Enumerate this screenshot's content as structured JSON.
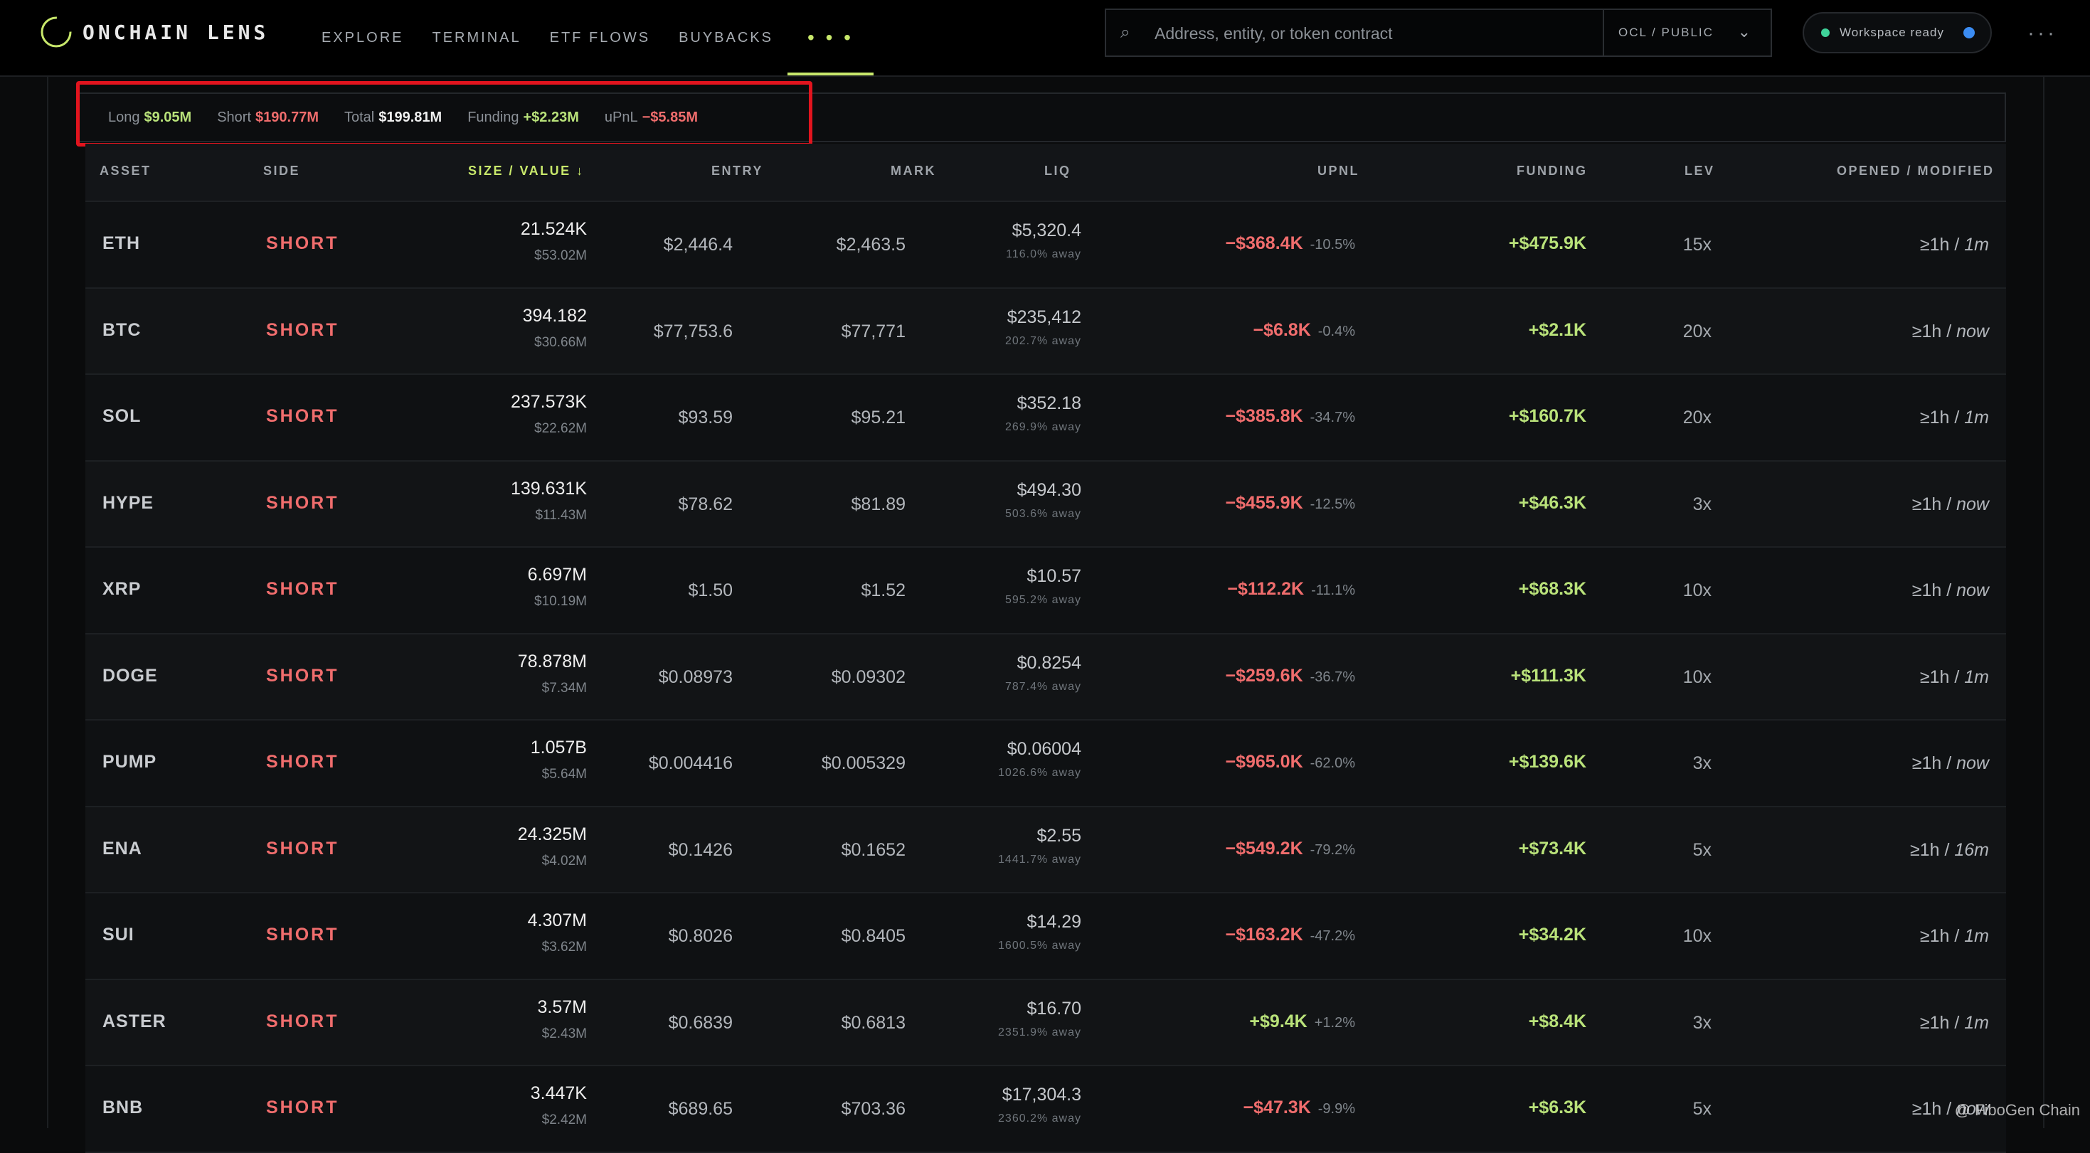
{
  "app": {
    "logo_text": "ONCHAIN LENS"
  },
  "nav": {
    "items": [
      "EXPLORE",
      "TERMINAL",
      "ETF FLOWS",
      "BUYBACKS"
    ],
    "more": "• • •"
  },
  "search": {
    "placeholder": "Address, entity, or token contract",
    "scope": "OCL / PUBLIC"
  },
  "workspace": {
    "status": "Workspace ready"
  },
  "summary": {
    "long_label": "Long",
    "long_value": "$9.05M",
    "short_label": "Short",
    "short_value": "$190.77M",
    "total_label": "Total",
    "total_value": "$199.81M",
    "funding_label": "Funding",
    "funding_value": "+$2.23M",
    "upnl_label": "uPnL",
    "upnl_value": "−$5.85M"
  },
  "table": {
    "headers": {
      "asset": "ASSET",
      "side": "SIDE",
      "size": "SIZE / VALUE ↓",
      "entry": "ENTRY",
      "mark": "MARK",
      "liq": "LIQ",
      "upnl": "UPNL",
      "funding": "FUNDING",
      "lev": "LEV",
      "opened": "OPENED / MODIFIED"
    },
    "rows": [
      {
        "asset": "ETH",
        "side": "SHORT",
        "size": "21.524K",
        "value": "$53.02M",
        "entry": "$2,446.4",
        "mark": "$2,463.5",
        "liq": "$5,320.4",
        "liq_away": "116.0% away",
        "upnl": "−$368.4K",
        "upnl_pct": "-10.5%",
        "upnl_positive": false,
        "funding": "+$475.9K",
        "lev": "15x",
        "opened": "≥1h / ",
        "modified": "1m"
      },
      {
        "asset": "BTC",
        "side": "SHORT",
        "size": "394.182",
        "value": "$30.66M",
        "entry": "$77,753.6",
        "mark": "$77,771",
        "liq": "$235,412",
        "liq_away": "202.7% away",
        "upnl": "−$6.8K",
        "upnl_pct": "-0.4%",
        "upnl_positive": false,
        "funding": "+$2.1K",
        "lev": "20x",
        "opened": "≥1h / ",
        "modified": "now"
      },
      {
        "asset": "SOL",
        "side": "SHORT",
        "size": "237.573K",
        "value": "$22.62M",
        "entry": "$93.59",
        "mark": "$95.21",
        "liq": "$352.18",
        "liq_away": "269.9% away",
        "upnl": "−$385.8K",
        "upnl_pct": "-34.7%",
        "upnl_positive": false,
        "funding": "+$160.7K",
        "lev": "20x",
        "opened": "≥1h / ",
        "modified": "1m"
      },
      {
        "asset": "HYPE",
        "side": "SHORT",
        "size": "139.631K",
        "value": "$11.43M",
        "entry": "$78.62",
        "mark": "$81.89",
        "liq": "$494.30",
        "liq_away": "503.6% away",
        "upnl": "−$455.9K",
        "upnl_pct": "-12.5%",
        "upnl_positive": false,
        "funding": "+$46.3K",
        "lev": "3x",
        "opened": "≥1h / ",
        "modified": "now"
      },
      {
        "asset": "XRP",
        "side": "SHORT",
        "size": "6.697M",
        "value": "$10.19M",
        "entry": "$1.50",
        "mark": "$1.52",
        "liq": "$10.57",
        "liq_away": "595.2% away",
        "upnl": "−$112.2K",
        "upnl_pct": "-11.1%",
        "upnl_positive": false,
        "funding": "+$68.3K",
        "lev": "10x",
        "opened": "≥1h / ",
        "modified": "now"
      },
      {
        "asset": "DOGE",
        "side": "SHORT",
        "size": "78.878M",
        "value": "$7.34M",
        "entry": "$0.08973",
        "mark": "$0.09302",
        "liq": "$0.8254",
        "liq_away": "787.4% away",
        "upnl": "−$259.6K",
        "upnl_pct": "-36.7%",
        "upnl_positive": false,
        "funding": "+$111.3K",
        "lev": "10x",
        "opened": "≥1h / ",
        "modified": "1m"
      },
      {
        "asset": "PUMP",
        "side": "SHORT",
        "size": "1.057B",
        "value": "$5.64M",
        "entry": "$0.004416",
        "mark": "$0.005329",
        "liq": "$0.06004",
        "liq_away": "1026.6% away",
        "upnl": "−$965.0K",
        "upnl_pct": "-62.0%",
        "upnl_positive": false,
        "funding": "+$139.6K",
        "lev": "3x",
        "opened": "≥1h / ",
        "modified": "now"
      },
      {
        "asset": "ENA",
        "side": "SHORT",
        "size": "24.325M",
        "value": "$4.02M",
        "entry": "$0.1426",
        "mark": "$0.1652",
        "liq": "$2.55",
        "liq_away": "1441.7% away",
        "upnl": "−$549.2K",
        "upnl_pct": "-79.2%",
        "upnl_positive": false,
        "funding": "+$73.4K",
        "lev": "5x",
        "opened": "≥1h / ",
        "modified": "16m"
      },
      {
        "asset": "SUI",
        "side": "SHORT",
        "size": "4.307M",
        "value": "$3.62M",
        "entry": "$0.8026",
        "mark": "$0.8405",
        "liq": "$14.29",
        "liq_away": "1600.5% away",
        "upnl": "−$163.2K",
        "upnl_pct": "-47.2%",
        "upnl_positive": false,
        "funding": "+$34.2K",
        "lev": "10x",
        "opened": "≥1h / ",
        "modified": "1m"
      },
      {
        "asset": "ASTER",
        "side": "SHORT",
        "size": "3.57M",
        "value": "$2.43M",
        "entry": "$0.6839",
        "mark": "$0.6813",
        "liq": "$16.70",
        "liq_away": "2351.9% away",
        "upnl": "+$9.4K",
        "upnl_pct": "+1.2%",
        "upnl_positive": true,
        "funding": "+$8.4K",
        "lev": "3x",
        "opened": "≥1h / ",
        "modified": "1m"
      },
      {
        "asset": "BNB",
        "side": "SHORT",
        "size": "3.447K",
        "value": "$2.42M",
        "entry": "$689.65",
        "mark": "$703.36",
        "liq": "$17,304.3",
        "liq_away": "2360.2% away",
        "upnl": "−$47.3K",
        "upnl_pct": "-9.9%",
        "upnl_positive": false,
        "funding": "+$6.3K",
        "lev": "5x",
        "opened": "≥1h / ",
        "modified": "now"
      }
    ]
  },
  "watermark": "@ FiboGen Chain",
  "colors": {
    "positive": "#b9e27a",
    "negative": "#f06d6d",
    "accent": "#c8e86b",
    "highlight_box": "#e2141e"
  }
}
